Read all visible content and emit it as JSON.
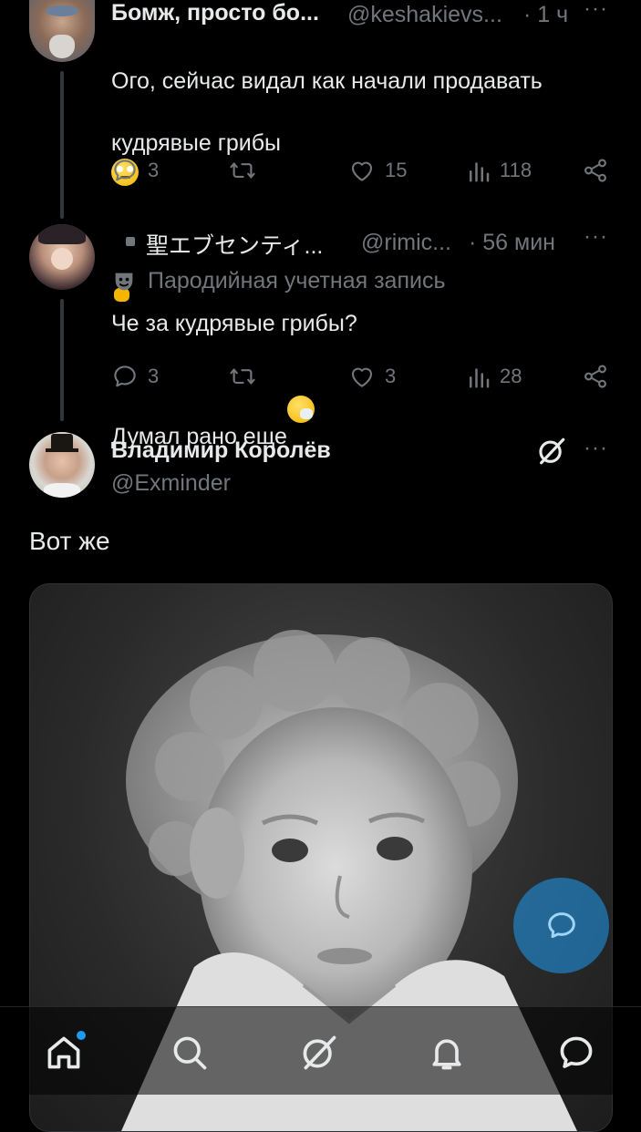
{
  "tweets": [
    {
      "author": "Бомж, просто бо...",
      "handle": "@keshakievs...",
      "time": "· 1 ч",
      "text_line1": "Ого, сейчас видал как начали продавать",
      "text_line2": "кудрявые грибы",
      "text_line3": "Думал рано еще",
      "replies": "3",
      "likes": "15",
      "views": "118"
    },
    {
      "author": "聖エブセンティ...",
      "handle": "@rimic...",
      "time": "· 56 мин",
      "parody_label": "Пародийная учетная запись",
      "text": "Че за кудрявые грибы?",
      "replies": "3",
      "likes": "3",
      "views": "28"
    },
    {
      "author": "Владимир Королёв",
      "handle": "@Exminder",
      "text": "Вот же"
    }
  ],
  "icons": {
    "reply": "reply-icon",
    "retweet": "retweet-icon",
    "like": "like-icon",
    "views": "views-icon",
    "share": "share-icon",
    "more": "more-icon",
    "grok": "grok-icon"
  },
  "bottom_nav": [
    "home-icon",
    "search-icon",
    "grok-icon",
    "notifications-icon",
    "messages-icon"
  ],
  "colors": {
    "background": "#000000",
    "text": "#e7e9ea",
    "muted": "#71767b",
    "accent": "#1d9bf0"
  }
}
